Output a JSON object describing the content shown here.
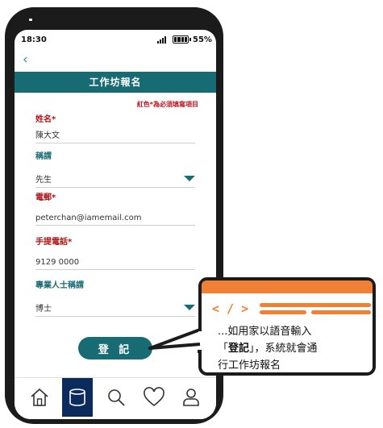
{
  "status": {
    "time": "18:30",
    "battery": "55%"
  },
  "app": {
    "back_glyph": "‹",
    "title": "工作坊報名",
    "required_note": "紅色*為必須填寫項目"
  },
  "form": {
    "name_label": "姓名*",
    "name_value": "陳大文",
    "title_label": "稱謂",
    "title_value": "先生",
    "email_label": "電郵*",
    "email_value": "peterchan@iamemail.com",
    "phone_label": "手提電話*",
    "phone_value": "9129 0000",
    "prof_label": "專業人士稱謂",
    "prof_value": "博士",
    "submit_label": "登 記"
  },
  "nav": {
    "items": [
      "home-icon",
      "database-icon",
      "search-icon",
      "heart-icon",
      "user-icon"
    ],
    "active": "database-icon"
  },
  "callout": {
    "code_glyph": "< / >",
    "line1": "...如用家以語音輸入",
    "line2_pre": "「",
    "line2_bold": "登記",
    "line2_post": "」，系統就會通",
    "line3": "行工作坊報名"
  },
  "colors": {
    "primary": "#176b72",
    "required": "#b31217",
    "nav_active": "#0a2b5c",
    "accent": "#f08035"
  }
}
